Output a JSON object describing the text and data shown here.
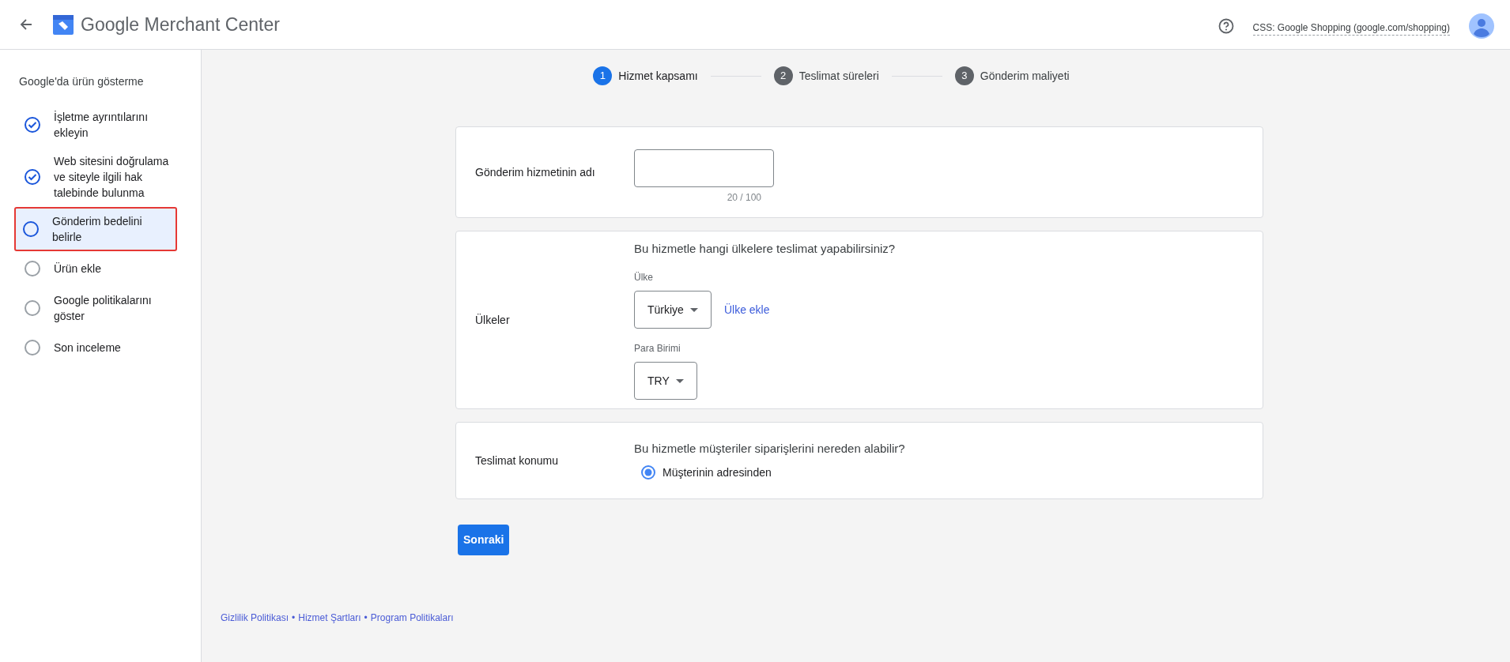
{
  "header": {
    "product_name": "Google Merchant Center",
    "css_label": "CSS: Google Shopping (google.com/shopping)"
  },
  "sidebar": {
    "title": "Google'da ürün gösterme",
    "items": [
      {
        "label": "İşletme ayrıntılarını ekleyin",
        "kind": "done",
        "selected": false,
        "outlined": false
      },
      {
        "label": "Web sitesini doğrulama ve siteyle ilgili hak talebinde bulunma",
        "kind": "done",
        "selected": false,
        "outlined": false
      },
      {
        "label": "Gönderim bedelini belirle",
        "kind": "current",
        "selected": true,
        "outlined": true
      },
      {
        "label": "Ürün ekle",
        "kind": "todo",
        "selected": false,
        "outlined": false
      },
      {
        "label": "Google politikalarını göster",
        "kind": "todo",
        "selected": false,
        "outlined": false
      },
      {
        "label": "Son inceleme",
        "kind": "todo",
        "selected": false,
        "outlined": false
      }
    ]
  },
  "stepper": [
    {
      "number": "1",
      "label": "Hizmet kapsamı",
      "selected": true
    },
    {
      "number": "2",
      "label": "Teslimat süreleri",
      "selected": false
    },
    {
      "number": "3",
      "label": "Gönderim maliyeti",
      "selected": false
    }
  ],
  "service_name": {
    "label": "Gönderim hizmetinin adı",
    "counter": "20 / 100"
  },
  "countries": {
    "label": "Ülkeler",
    "question": "Bu hizmetle hangi ülkelere teslimat yapabilirsiniz?",
    "country_label": "Ülke",
    "country_value": "Türkiye",
    "add_link": "Ülke ekle",
    "currency_label": "Para Birimi",
    "currency_value": "TRY"
  },
  "delivery": {
    "label": "Teslimat konumu",
    "question": "Bu hizmetle müşteriler siparişlerini nereden alabilir?",
    "options": [
      {
        "label": "Müşterinin adresinden",
        "selected": true
      }
    ]
  },
  "next_button": "Sonraki",
  "footer": {
    "links": [
      "Gizlilik Politikası",
      "Hizmet Şartları",
      "Program Politikaları"
    ],
    "separator": "•"
  }
}
